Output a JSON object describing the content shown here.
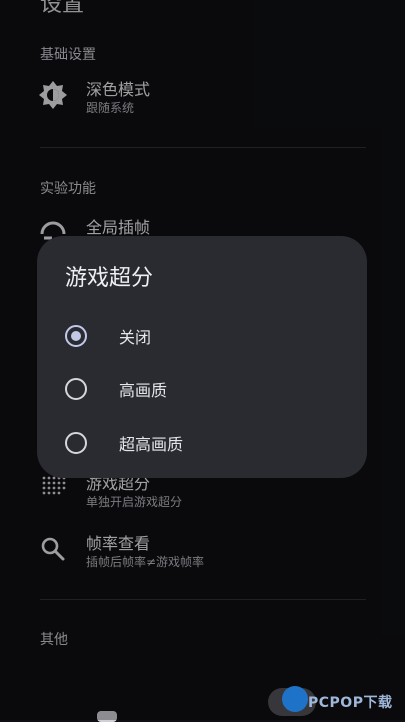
{
  "page": {
    "title": "设置"
  },
  "sections": {
    "basic": {
      "header": "基础设置",
      "dark_mode": {
        "title": "深色模式",
        "subtitle": "跟随系统",
        "icon": "brightness-auto-icon"
      }
    },
    "experimental": {
      "header": "实验功能",
      "global_frame_interp": {
        "title": "全局插帧",
        "icon": "frame-interpolation-icon"
      },
      "game_super_res": {
        "title": "游戏超分",
        "subtitle": "单独开启游戏超分",
        "icon": "dot-grid-icon"
      },
      "frame_rate_view": {
        "title": "帧率查看",
        "subtitle": "插帧后帧率≠游戏帧率",
        "icon": "search-icon"
      }
    },
    "other": {
      "header": "其他"
    }
  },
  "dialog": {
    "title": "游戏超分",
    "options": [
      {
        "label": "关闭",
        "checked": true
      },
      {
        "label": "高画质",
        "checked": false
      },
      {
        "label": "超高画质",
        "checked": false
      }
    ]
  },
  "watermark": {
    "text": "PCPOP下载"
  },
  "colors": {
    "background": "#0f1013",
    "dialog": "#2a2b31",
    "accent": "#c4c8e8"
  }
}
